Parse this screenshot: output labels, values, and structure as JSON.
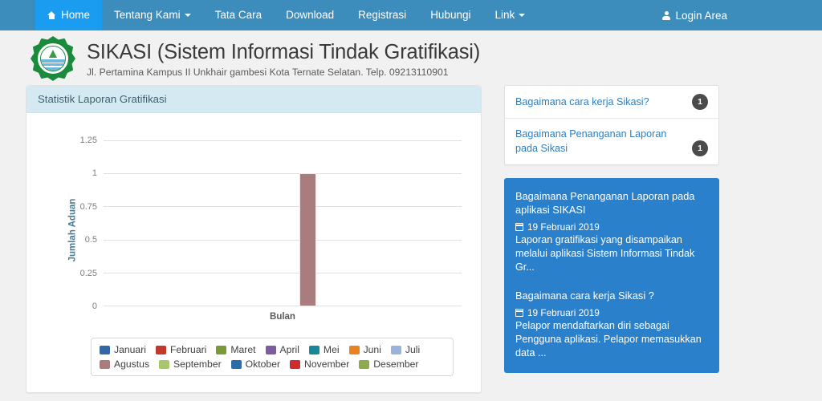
{
  "navbar": {
    "brand_color": "#3c8dbc",
    "active_color": "#1a9cf0",
    "items": [
      {
        "label": "Home",
        "icon": "home-icon",
        "active": true,
        "caret": false
      },
      {
        "label": "Tentang Kami",
        "icon": "",
        "active": false,
        "caret": true
      },
      {
        "label": "Tata Cara",
        "icon": "",
        "active": false,
        "caret": false
      },
      {
        "label": "Download",
        "icon": "",
        "active": false,
        "caret": false
      },
      {
        "label": "Registrasi",
        "icon": "",
        "active": false,
        "caret": false
      },
      {
        "label": "Hubungi",
        "icon": "",
        "active": false,
        "caret": false
      },
      {
        "label": "Link",
        "icon": "",
        "active": false,
        "caret": true
      }
    ],
    "login": {
      "label": "Login Area",
      "icon": "user-icon"
    }
  },
  "header": {
    "logo_icon": "university-seal-logo",
    "title": "SIKASI (Sistem Informasi Tindak Gratifikasi)",
    "subtitle": "Jl. Pertamina Kampus II Unkhair gambesi Kota Ternate Selatan. Telp. 09213110901"
  },
  "chart_panel": {
    "heading": "Statistik Laporan Gratifikasi"
  },
  "chart_data": {
    "type": "bar",
    "title": "Statistik Laporan Gratifikasi",
    "xlabel": "Bulan",
    "ylabel": "Jumlah Aduan",
    "categories": [
      "Bulan"
    ],
    "ylim": [
      0,
      1.25
    ],
    "yticks": [
      "0",
      "0.25",
      "0.5",
      "0.75",
      "1",
      "1.25"
    ],
    "ytick_values": [
      0,
      0.25,
      0.5,
      0.75,
      1,
      1.25
    ],
    "grid": true,
    "legend_position": "bottom",
    "series": [
      {
        "name": "Januari",
        "values": [
          0
        ],
        "color": "#3465a4"
      },
      {
        "name": "Februari",
        "values": [
          0
        ],
        "color": "#c0392b"
      },
      {
        "name": "Maret",
        "values": [
          0
        ],
        "color": "#7a9a3a"
      },
      {
        "name": "April",
        "values": [
          0
        ],
        "color": "#7c5ba0"
      },
      {
        "name": "Mei",
        "values": [
          0
        ],
        "color": "#15889a"
      },
      {
        "name": "Juni",
        "values": [
          0
        ],
        "color": "#e8821e"
      },
      {
        "name": "Juli",
        "values": [
          0
        ],
        "color": "#9ab3dd"
      },
      {
        "name": "Agustus",
        "values": [
          1
        ],
        "color": "#a97d7d"
      },
      {
        "name": "September",
        "values": [
          0
        ],
        "color": "#a8c66c"
      },
      {
        "name": "Oktober",
        "values": [
          0
        ],
        "color": "#2a6ba8"
      },
      {
        "name": "November",
        "values": [
          0
        ],
        "color": "#cf2d2d"
      },
      {
        "name": "Desember",
        "values": [
          0
        ],
        "color": "#8faa4a"
      }
    ]
  },
  "faq": {
    "items": [
      {
        "label": "Bagaimana cara kerja Sikasi?",
        "badge": "1"
      },
      {
        "label": "Bagaimana Penanganan Laporan pada Sikasi",
        "badge": "1"
      }
    ]
  },
  "news": {
    "items": [
      {
        "title": "Bagaimana Penanganan Laporan pada aplikasi SIKASI",
        "date": "19 Februari 2019",
        "date_icon": "calendar-icon",
        "excerpt": "Laporan gratifikasi yang disampaikan melalui aplikasi Sistem Informasi Tindak Gr..."
      },
      {
        "title": "Bagaimana cara kerja Sikasi ?",
        "date": "19 Februari 2019",
        "date_icon": "calendar-icon",
        "excerpt": "Pelapor mendaftarkan diri sebagai Pengguna aplikasi. Pelapor memasukkan data ..."
      }
    ]
  }
}
